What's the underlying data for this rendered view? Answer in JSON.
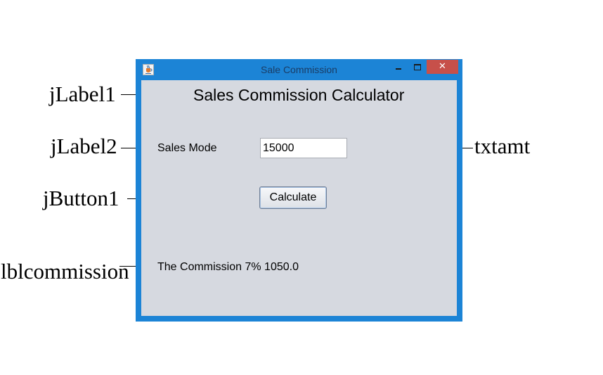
{
  "annotations": {
    "jlabel1": "jLabel1",
    "jlabel2": "jLabel2",
    "jbutton1": "jButton1",
    "lblcommission": "lblcommission",
    "txtamt": "txtamt"
  },
  "window": {
    "title": "Sale Commission",
    "close_glyph": "✕",
    "icon": "java-cup-icon",
    "frame_color": "#1c84d6",
    "close_color": "#c7504a",
    "client_color": "#d6d9e0"
  },
  "form": {
    "heading": "Sales Commission Calculator",
    "sales_label": "Sales Mode",
    "amount_value": "15000",
    "calculate_label": "Calculate",
    "commission_text": "The Commission 7% 1050.0"
  }
}
